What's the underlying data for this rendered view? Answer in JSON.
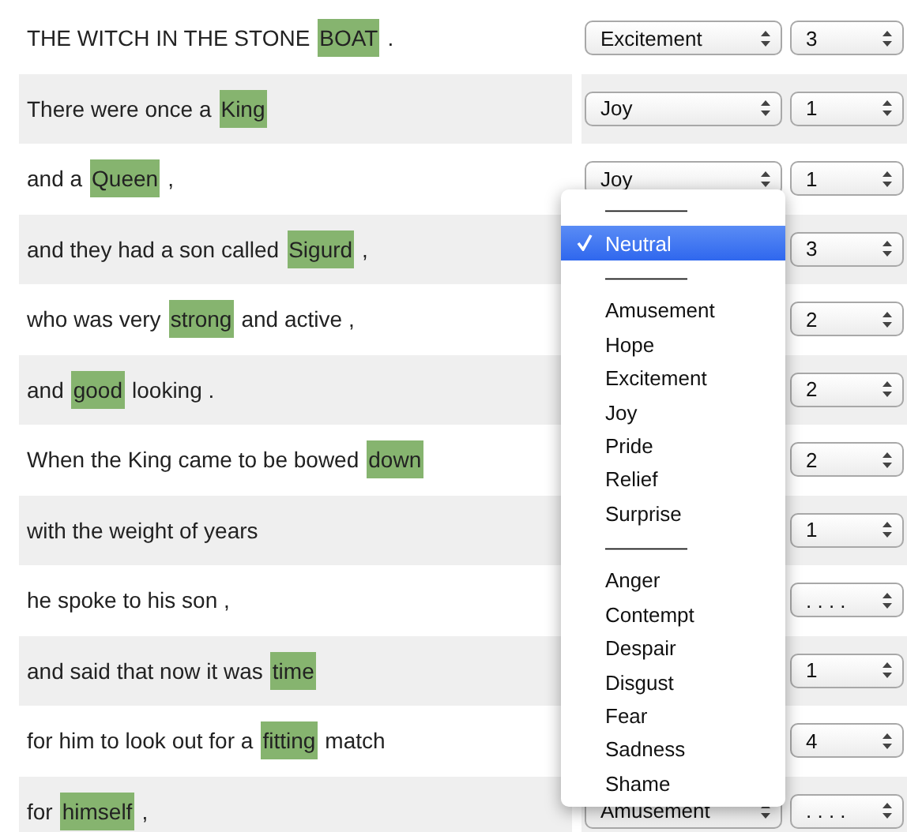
{
  "rows": [
    {
      "segments": [
        {
          "text": "THE WITCH IN THE STONE"
        },
        {
          "text": "BOAT",
          "highlighted": true
        },
        {
          "text": "."
        }
      ],
      "emotion": "Excitement",
      "intensity": "3"
    },
    {
      "segments": [
        {
          "text": "There were once a"
        },
        {
          "text": "King",
          "highlighted": true
        }
      ],
      "emotion": "Joy",
      "intensity": "1"
    },
    {
      "segments": [
        {
          "text": "and a"
        },
        {
          "text": "Queen",
          "highlighted": true
        },
        {
          "text": ","
        }
      ],
      "emotion": "Joy",
      "intensity": "1"
    },
    {
      "segments": [
        {
          "text": "and they had a son called"
        },
        {
          "text": "Sigurd",
          "highlighted": true
        },
        {
          "text": ","
        }
      ],
      "intensity": "3"
    },
    {
      "segments": [
        {
          "text": "who was very"
        },
        {
          "text": "strong",
          "highlighted": true
        },
        {
          "text": "and active ,"
        }
      ],
      "intensity": "2"
    },
    {
      "segments": [
        {
          "text": "and"
        },
        {
          "text": "good",
          "highlighted": true
        },
        {
          "text": "looking ."
        }
      ],
      "intensity": "2"
    },
    {
      "segments": [
        {
          "text": "When the King came to be bowed"
        },
        {
          "text": "down",
          "highlighted": true
        }
      ],
      "intensity": "2"
    },
    {
      "segments": [
        {
          "text": "with the weight of years"
        }
      ],
      "intensity": "1"
    },
    {
      "segments": [
        {
          "text": "he spoke to his son ,"
        }
      ],
      "intensity": ". . . ."
    },
    {
      "segments": [
        {
          "text": "and said that now it was"
        },
        {
          "text": "time",
          "highlighted": true
        }
      ],
      "intensity": "1"
    },
    {
      "segments": [
        {
          "text": "for him to look out for a"
        },
        {
          "text": "fitting",
          "highlighted": true
        },
        {
          "text": "match"
        }
      ],
      "intensity": "4"
    },
    {
      "segments": [
        {
          "text": "for"
        },
        {
          "text": "himself",
          "highlighted": true
        },
        {
          "text": ","
        }
      ],
      "emotion": "Amusement",
      "intensity": ". . . ."
    }
  ],
  "emotion_menu": {
    "items": [
      {
        "label": "————",
        "selected": false
      },
      {
        "label": "Neutral",
        "selected": true
      },
      {
        "label": "————",
        "selected": false
      },
      {
        "label": "Amusement",
        "selected": false
      },
      {
        "label": "Hope",
        "selected": false
      },
      {
        "label": "Excitement",
        "selected": false
      },
      {
        "label": "Joy",
        "selected": false
      },
      {
        "label": "Pride",
        "selected": false
      },
      {
        "label": "Relief",
        "selected": false
      },
      {
        "label": "Surprise",
        "selected": false
      },
      {
        "label": "————",
        "selected": false
      },
      {
        "label": "Anger",
        "selected": false
      },
      {
        "label": "Contempt",
        "selected": false
      },
      {
        "label": "Despair",
        "selected": false
      },
      {
        "label": "Disgust",
        "selected": false
      },
      {
        "label": "Fear",
        "selected": false
      },
      {
        "label": "Sadness",
        "selected": false
      },
      {
        "label": "Shame",
        "selected": false
      }
    ]
  }
}
